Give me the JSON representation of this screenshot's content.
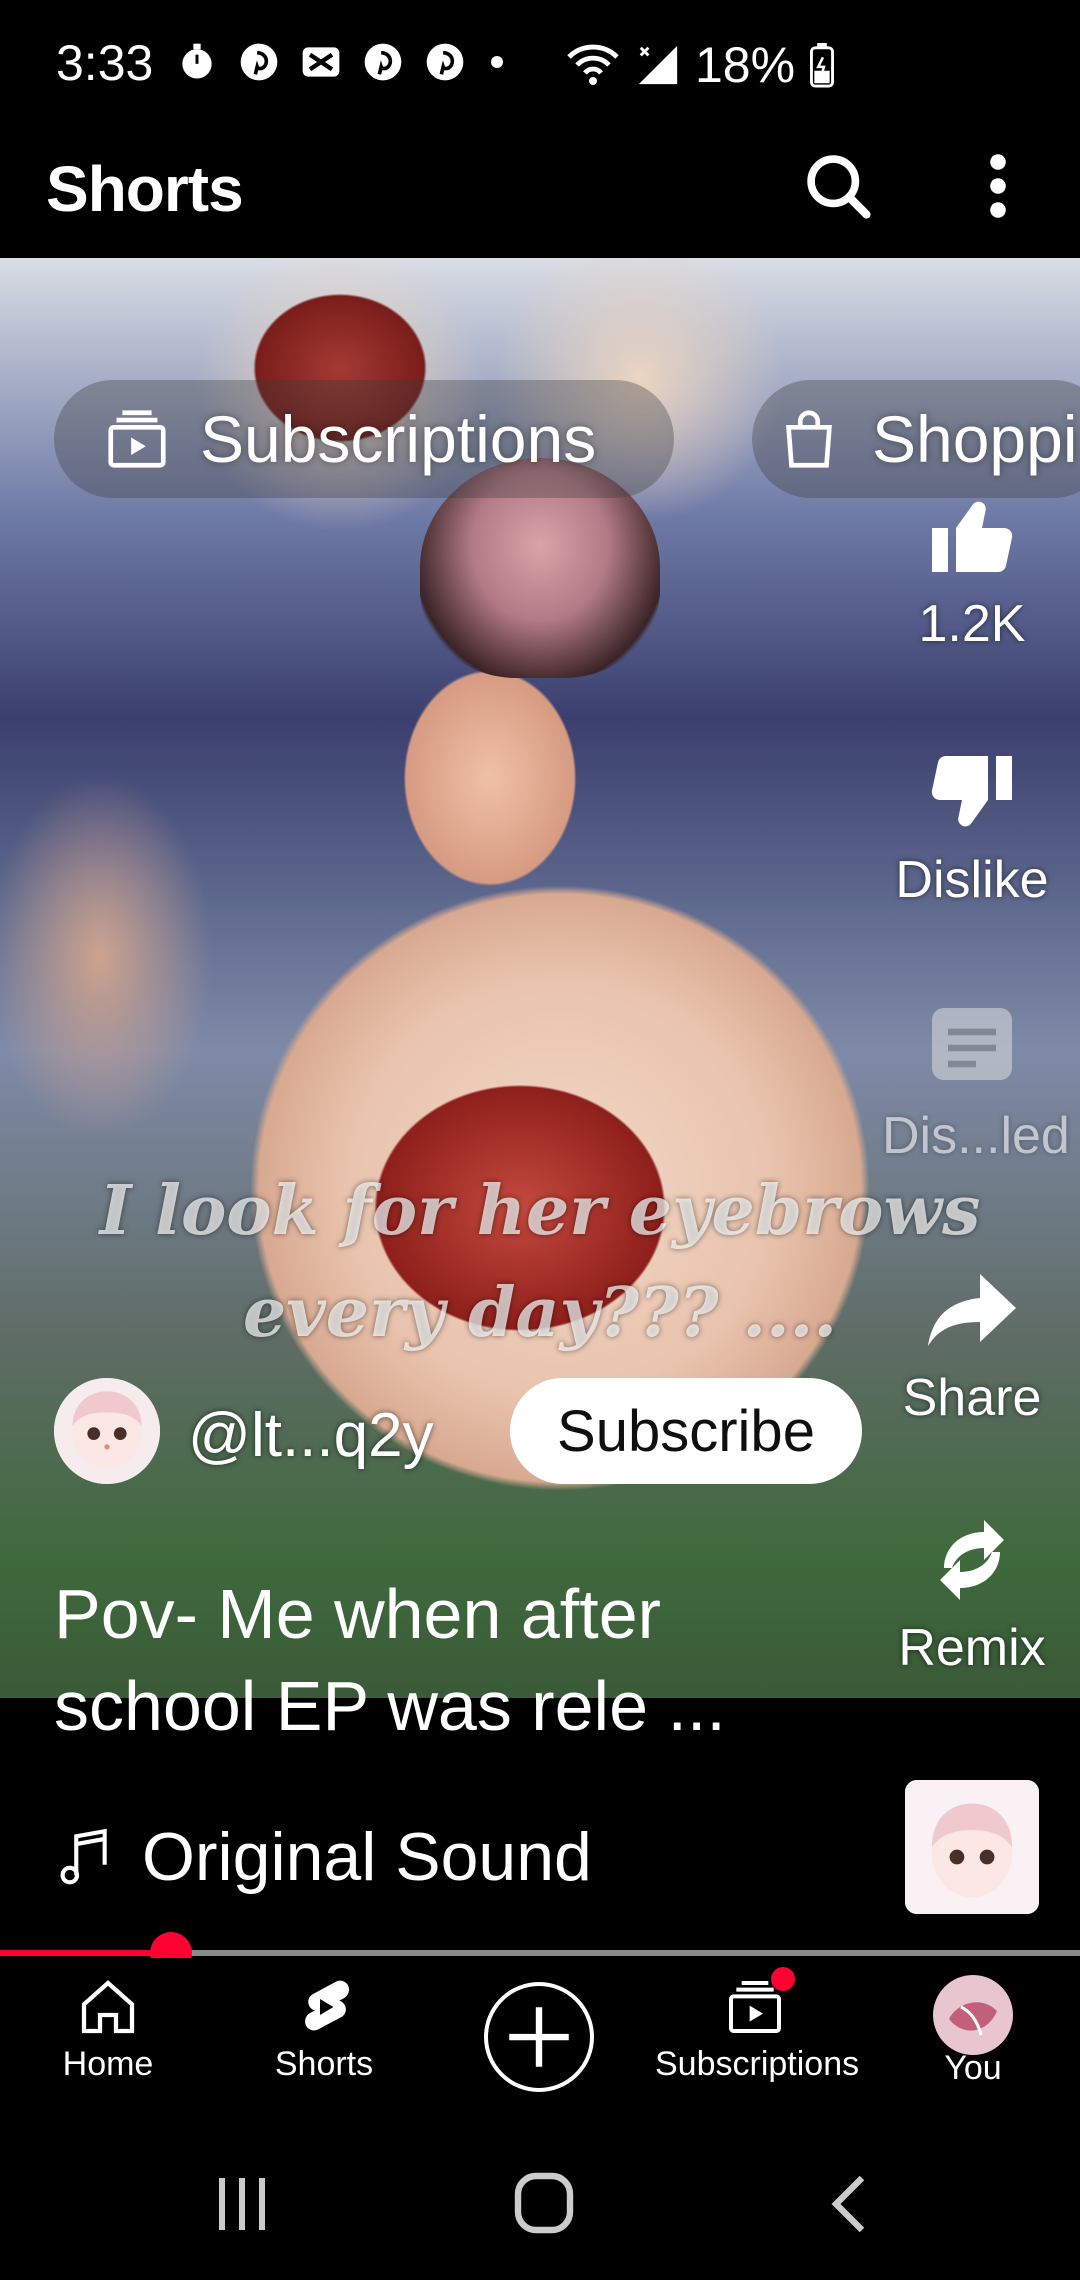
{
  "status_bar": {
    "time": "3:33",
    "battery_percent": "18%",
    "notification_icons": [
      "stopwatch-icon",
      "pinterest-icon",
      "x-app-icon",
      "pinterest-icon",
      "pinterest-icon",
      "dot-icon"
    ],
    "signal_icons": [
      "wifi-icon",
      "cellular-icon",
      "battery-charging-icon"
    ]
  },
  "app_bar": {
    "title": "Shorts",
    "search_icon": "search-icon",
    "more_icon": "more-vert-icon"
  },
  "chips": [
    {
      "label": "Subscriptions",
      "icon": "subscriptions-icon"
    },
    {
      "label": "Shoppi",
      "icon": "shopping-bag-icon"
    }
  ],
  "actions": {
    "like": {
      "label": "1.2K",
      "icon": "thumb-up-icon"
    },
    "dislike": {
      "label": "Dislike",
      "icon": "thumb-down-icon"
    },
    "comments": {
      "label": "Dis...led",
      "icon": "comment-icon"
    },
    "share": {
      "label": "Share",
      "icon": "share-icon"
    },
    "remix": {
      "label": "Remix",
      "icon": "remix-icon"
    }
  },
  "video": {
    "overlay_text_line1": "I look for her eyebrows",
    "overlay_text_line2": "every day??? ....",
    "channel_handle": "@lt...q2y",
    "subscribe_label": "Subscribe",
    "title_line1": "Pov- Me when after",
    "title_line2": "school EP was rele ...",
    "sound_label": "Original Sound",
    "progress_fraction": 0.158
  },
  "bottom_nav": {
    "items": [
      {
        "label": "Home",
        "icon": "home-icon"
      },
      {
        "label": "Shorts",
        "icon": "shorts-icon"
      },
      {
        "label": "",
        "icon": "create-plus-icon"
      },
      {
        "label": "Subscriptions",
        "icon": "subscriptions-icon"
      },
      {
        "label": "You",
        "icon": "avatar-icon"
      }
    ]
  },
  "colors": {
    "accent_red": "#ff0033",
    "background": "#000000",
    "subscribe_bg": "#ffffff"
  }
}
